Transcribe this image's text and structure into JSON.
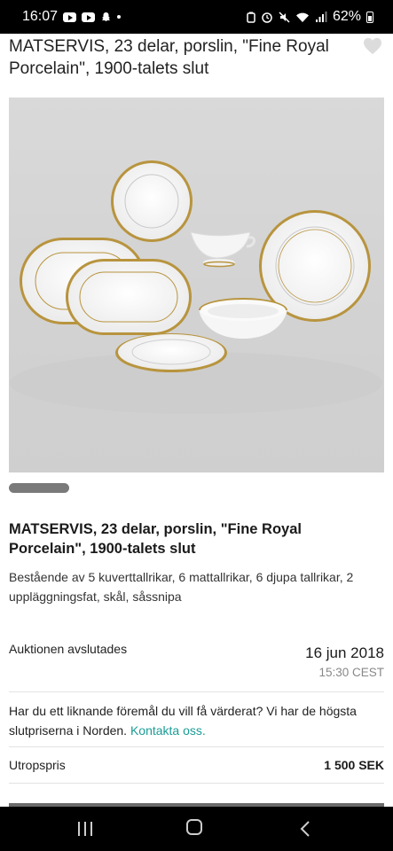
{
  "status_bar": {
    "time": "16:07",
    "battery": "62%"
  },
  "listing": {
    "heading": "MATSERVIS, 23 delar, porslin, \"Fine Royal Porcelain\", 1900-talets slut",
    "title": "MATSERVIS, 23 delar, porslin, \"Fine Royal Porcelain\", 1900-talets slut",
    "description": "Bestående av 5 kuverttallrikar, 6 mattallrikar, 6 djupa tallrikar, 2 uppläggningsfat, skål, såssnipa"
  },
  "auction": {
    "label": "Auktionen avslutades",
    "date": "16 jun 2018",
    "time": "15:30 CEST"
  },
  "valuation": {
    "text": "Har du ett liknande föremål du vill få värderat? Vi har de högsta slutpriserna i Norden.",
    "link": "Kontakta oss."
  },
  "starting_price": {
    "label": "Utropspris",
    "value": "1 500 SEK"
  },
  "icons": {
    "favorite": "heart-icon",
    "nav_recent": "recent-apps-icon",
    "nav_home": "home-icon",
    "nav_back": "back-icon"
  },
  "colors": {
    "link": "#1a9c96",
    "gold_rim": "#b8943e"
  }
}
